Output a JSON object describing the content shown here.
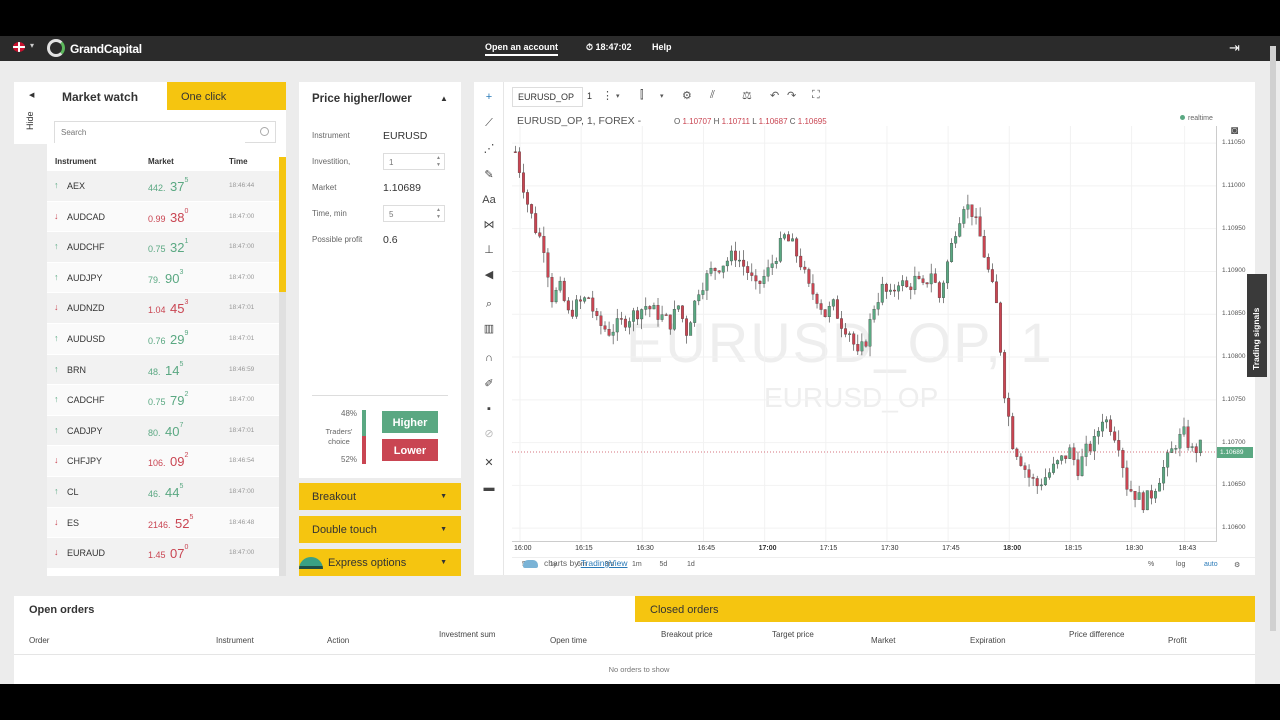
{
  "topbar": {
    "brand": "GrandCapital",
    "open_account": "Open an account",
    "clock": "⏱ 18:47:02",
    "help": "Help"
  },
  "sidebar_tab": {
    "hide": "Hide"
  },
  "market_watch": {
    "tab_active": "Market watch",
    "tab_other": "One click",
    "search_placeholder": "Search",
    "columns": [
      "Instrument",
      "Market",
      "Time"
    ],
    "rows": [
      {
        "dir": "up",
        "symbol": "AEX",
        "pa": "442.",
        "pb": "37",
        "pc": "5",
        "time": "18:46:44"
      },
      {
        "dir": "down",
        "symbol": "AUDCAD",
        "pa": "0.99",
        "pb": "38",
        "pc": "0",
        "time": "18:47:00"
      },
      {
        "dir": "up",
        "symbol": "AUDCHF",
        "pa": "0.75",
        "pb": "32",
        "pc": "1",
        "time": "18:47:00"
      },
      {
        "dir": "up",
        "symbol": "AUDJPY",
        "pa": "79.",
        "pb": "90",
        "pc": "3",
        "time": "18:47:00"
      },
      {
        "dir": "down",
        "symbol": "AUDNZD",
        "pa": "1.04",
        "pb": "45",
        "pc": "3",
        "time": "18:47:01"
      },
      {
        "dir": "up",
        "symbol": "AUDUSD",
        "pa": "0.76",
        "pb": "29",
        "pc": "9",
        "time": "18:47:01"
      },
      {
        "dir": "up",
        "symbol": "BRN",
        "pa": "48.",
        "pb": "14",
        "pc": "5",
        "time": "18:46:59"
      },
      {
        "dir": "up",
        "symbol": "CADCHF",
        "pa": "0.75",
        "pb": "79",
        "pc": "2",
        "time": "18:47:00"
      },
      {
        "dir": "up",
        "symbol": "CADJPY",
        "pa": "80.",
        "pb": "40",
        "pc": "7",
        "time": "18:47:01"
      },
      {
        "dir": "down",
        "symbol": "CHFJPY",
        "pa": "106.",
        "pb": "09",
        "pc": "2",
        "time": "18:46:54"
      },
      {
        "dir": "up",
        "symbol": "CL",
        "pa": "46.",
        "pb": "44",
        "pc": "5",
        "time": "18:47:00"
      },
      {
        "dir": "down",
        "symbol": "ES",
        "pa": "2146.",
        "pb": "52",
        "pc": "5",
        "time": "18:46:48"
      },
      {
        "dir": "down",
        "symbol": "EURAUD",
        "pa": "1.45",
        "pb": "07",
        "pc": "0",
        "time": "18:47:00"
      }
    ]
  },
  "price_panel": {
    "title": "Price higher/lower",
    "instrument_label": "Instrument",
    "instrument_value": "EURUSD",
    "investition_label": "Investition,",
    "investition_value": "1",
    "market_label": "Market",
    "market_value": "1.10689",
    "time_label": "Time, min",
    "time_value": "5",
    "profit_label": "Possible profit",
    "profit_value": "0.6",
    "higher_pct": "48%",
    "lower_pct": "52%",
    "traders_choice": "Traders' choice",
    "higher_share": 0.48,
    "higher_btn": "Higher",
    "lower_btn": "Lower"
  },
  "accordions": [
    "Breakout",
    "Double touch",
    "Express options"
  ],
  "chart_toolbar": {
    "symbol": "EURUSD_OP",
    "interval": "1"
  },
  "chart_legend": {
    "title": "EURUSD_OP, 1, FOREX -",
    "o": "1.10707",
    "h": "1.10711",
    "l": "1.10687",
    "c": "1.10695",
    "realtime": "realtime",
    "watermark": "EURUSD_OP, 1",
    "watermark_sub": "EURUSD_OP",
    "attribution_pre": "charts by",
    "attribution_link": "TradingView",
    "current_price": "1.10689"
  },
  "chart_ranges": [
    "5y",
    "1y",
    "6m",
    "3m",
    "1m",
    "5d",
    "1d"
  ],
  "chart_scale_opts": [
    "%",
    "log",
    "auto"
  ],
  "colors": {
    "up": "#5aa882",
    "down": "#c94552",
    "accent": "#f5c510"
  },
  "chart_data": {
    "type": "candlestick",
    "x_ticks": [
      "16:00",
      "16:15",
      "16:30",
      "16:45",
      "17:00",
      "17:15",
      "17:30",
      "17:45",
      "18:00",
      "18:15",
      "18:30",
      "18:43"
    ],
    "y_ticks": [
      "1.11050",
      "1.11000",
      "1.10950",
      "1.10900",
      "1.10850",
      "1.10800",
      "1.10750",
      "1.10700",
      "1.10650",
      "1.10600"
    ],
    "ylim": [
      1.10585,
      1.1107
    ],
    "x_range_minutes": [
      0,
      168
    ],
    "close_path": [
      [
        0,
        1.1104
      ],
      [
        3,
        1.1098
      ],
      [
        5,
        1.1095
      ],
      [
        7,
        1.1093
      ],
      [
        9,
        1.1087
      ],
      [
        11,
        1.1088
      ],
      [
        13,
        1.1085
      ],
      [
        15,
        1.1086
      ],
      [
        18,
        1.1087
      ],
      [
        20,
        1.1084
      ],
      [
        23,
        1.1083
      ],
      [
        26,
        1.1084
      ],
      [
        29,
        1.1085
      ],
      [
        32,
        1.1086
      ],
      [
        35,
        1.1085
      ],
      [
        38,
        1.1084
      ],
      [
        40,
        1.1086
      ],
      [
        42,
        1.1083
      ],
      [
        45,
        1.1088
      ],
      [
        48,
        1.109
      ],
      [
        51,
        1.1091
      ],
      [
        54,
        1.1092
      ],
      [
        57,
        1.109
      ],
      [
        59,
        1.1088
      ],
      [
        62,
        1.109
      ],
      [
        64,
        1.1092
      ],
      [
        66,
        1.1094
      ],
      [
        68,
        1.1093
      ],
      [
        70,
        1.1091
      ],
      [
        72,
        1.1088
      ],
      [
        74,
        1.1087
      ],
      [
        76,
        1.1085
      ],
      [
        78,
        1.1086
      ],
      [
        80,
        1.1084
      ],
      [
        82,
        1.1083
      ],
      [
        84,
        1.108
      ],
      [
        86,
        1.1082
      ],
      [
        88,
        1.1086
      ],
      [
        90,
        1.1088
      ],
      [
        92,
        1.1087
      ],
      [
        94,
        1.1089
      ],
      [
        96,
        1.1088
      ],
      [
        98,
        1.1089
      ],
      [
        100,
        1.1088
      ],
      [
        102,
        1.109
      ],
      [
        104,
        1.1087
      ],
      [
        106,
        1.1091
      ],
      [
        108,
        1.1095
      ],
      [
        110,
        1.1098
      ],
      [
        112,
        1.1097
      ],
      [
        114,
        1.1094
      ],
      [
        116,
        1.109
      ],
      [
        118,
        1.1086
      ],
      [
        120,
        1.1076
      ],
      [
        122,
        1.107
      ],
      [
        124,
        1.1068
      ],
      [
        126,
        1.1066
      ],
      [
        128,
        1.1065
      ],
      [
        130,
        1.1066
      ],
      [
        132,
        1.1067
      ],
      [
        134,
        1.1068
      ],
      [
        136,
        1.1069
      ],
      [
        138,
        1.1067
      ],
      [
        140,
        1.1069
      ],
      [
        142,
        1.107
      ],
      [
        144,
        1.1073
      ],
      [
        146,
        1.1072
      ],
      [
        148,
        1.107
      ],
      [
        150,
        1.1065
      ],
      [
        152,
        1.1064
      ],
      [
        154,
        1.1063
      ],
      [
        156,
        1.1064
      ],
      [
        158,
        1.1066
      ],
      [
        160,
        1.1068
      ],
      [
        162,
        1.107
      ],
      [
        164,
        1.1071
      ],
      [
        166,
        1.1069
      ],
      [
        168,
        1.10695
      ]
    ]
  },
  "orders": {
    "tab_open": "Open orders",
    "tab_closed": "Closed orders",
    "columns": [
      "Order",
      "Instrument",
      "Action",
      "Investment sum",
      "Open time",
      "Breakout price",
      "Target price",
      "Market",
      "Expiration",
      "Price difference",
      "Profit"
    ],
    "empty": "No orders to show"
  },
  "signals": "Trading signals"
}
